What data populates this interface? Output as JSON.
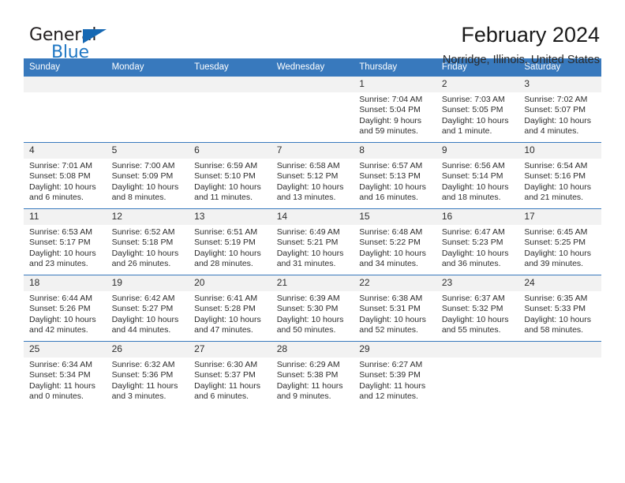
{
  "brand": {
    "name_dark": "General",
    "name_blue": "Blue",
    "accent_color": "#1f77c4",
    "triangle_color": "#1668b3"
  },
  "header": {
    "title": "February 2024",
    "subtitle": "Norridge, Illinois, United States",
    "header_bg": "#3879bd",
    "daynum_bg": "#f2f2f2"
  },
  "weekdays": [
    "Sunday",
    "Monday",
    "Tuesday",
    "Wednesday",
    "Thursday",
    "Friday",
    "Saturday"
  ],
  "weeks": [
    [
      {
        "day": ""
      },
      {
        "day": ""
      },
      {
        "day": ""
      },
      {
        "day": ""
      },
      {
        "day": "1",
        "sunrise": "Sunrise: 7:04 AM",
        "sunset": "Sunset: 5:04 PM",
        "daylight1": "Daylight: 9 hours",
        "daylight2": "and 59 minutes."
      },
      {
        "day": "2",
        "sunrise": "Sunrise: 7:03 AM",
        "sunset": "Sunset: 5:05 PM",
        "daylight1": "Daylight: 10 hours",
        "daylight2": "and 1 minute."
      },
      {
        "day": "3",
        "sunrise": "Sunrise: 7:02 AM",
        "sunset": "Sunset: 5:07 PM",
        "daylight1": "Daylight: 10 hours",
        "daylight2": "and 4 minutes."
      }
    ],
    [
      {
        "day": "4",
        "sunrise": "Sunrise: 7:01 AM",
        "sunset": "Sunset: 5:08 PM",
        "daylight1": "Daylight: 10 hours",
        "daylight2": "and 6 minutes."
      },
      {
        "day": "5",
        "sunrise": "Sunrise: 7:00 AM",
        "sunset": "Sunset: 5:09 PM",
        "daylight1": "Daylight: 10 hours",
        "daylight2": "and 8 minutes."
      },
      {
        "day": "6",
        "sunrise": "Sunrise: 6:59 AM",
        "sunset": "Sunset: 5:10 PM",
        "daylight1": "Daylight: 10 hours",
        "daylight2": "and 11 minutes."
      },
      {
        "day": "7",
        "sunrise": "Sunrise: 6:58 AM",
        "sunset": "Sunset: 5:12 PM",
        "daylight1": "Daylight: 10 hours",
        "daylight2": "and 13 minutes."
      },
      {
        "day": "8",
        "sunrise": "Sunrise: 6:57 AM",
        "sunset": "Sunset: 5:13 PM",
        "daylight1": "Daylight: 10 hours",
        "daylight2": "and 16 minutes."
      },
      {
        "day": "9",
        "sunrise": "Sunrise: 6:56 AM",
        "sunset": "Sunset: 5:14 PM",
        "daylight1": "Daylight: 10 hours",
        "daylight2": "and 18 minutes."
      },
      {
        "day": "10",
        "sunrise": "Sunrise: 6:54 AM",
        "sunset": "Sunset: 5:16 PM",
        "daylight1": "Daylight: 10 hours",
        "daylight2": "and 21 minutes."
      }
    ],
    [
      {
        "day": "11",
        "sunrise": "Sunrise: 6:53 AM",
        "sunset": "Sunset: 5:17 PM",
        "daylight1": "Daylight: 10 hours",
        "daylight2": "and 23 minutes."
      },
      {
        "day": "12",
        "sunrise": "Sunrise: 6:52 AM",
        "sunset": "Sunset: 5:18 PM",
        "daylight1": "Daylight: 10 hours",
        "daylight2": "and 26 minutes."
      },
      {
        "day": "13",
        "sunrise": "Sunrise: 6:51 AM",
        "sunset": "Sunset: 5:19 PM",
        "daylight1": "Daylight: 10 hours",
        "daylight2": "and 28 minutes."
      },
      {
        "day": "14",
        "sunrise": "Sunrise: 6:49 AM",
        "sunset": "Sunset: 5:21 PM",
        "daylight1": "Daylight: 10 hours",
        "daylight2": "and 31 minutes."
      },
      {
        "day": "15",
        "sunrise": "Sunrise: 6:48 AM",
        "sunset": "Sunset: 5:22 PM",
        "daylight1": "Daylight: 10 hours",
        "daylight2": "and 34 minutes."
      },
      {
        "day": "16",
        "sunrise": "Sunrise: 6:47 AM",
        "sunset": "Sunset: 5:23 PM",
        "daylight1": "Daylight: 10 hours",
        "daylight2": "and 36 minutes."
      },
      {
        "day": "17",
        "sunrise": "Sunrise: 6:45 AM",
        "sunset": "Sunset: 5:25 PM",
        "daylight1": "Daylight: 10 hours",
        "daylight2": "and 39 minutes."
      }
    ],
    [
      {
        "day": "18",
        "sunrise": "Sunrise: 6:44 AM",
        "sunset": "Sunset: 5:26 PM",
        "daylight1": "Daylight: 10 hours",
        "daylight2": "and 42 minutes."
      },
      {
        "day": "19",
        "sunrise": "Sunrise: 6:42 AM",
        "sunset": "Sunset: 5:27 PM",
        "daylight1": "Daylight: 10 hours",
        "daylight2": "and 44 minutes."
      },
      {
        "day": "20",
        "sunrise": "Sunrise: 6:41 AM",
        "sunset": "Sunset: 5:28 PM",
        "daylight1": "Daylight: 10 hours",
        "daylight2": "and 47 minutes."
      },
      {
        "day": "21",
        "sunrise": "Sunrise: 6:39 AM",
        "sunset": "Sunset: 5:30 PM",
        "daylight1": "Daylight: 10 hours",
        "daylight2": "and 50 minutes."
      },
      {
        "day": "22",
        "sunrise": "Sunrise: 6:38 AM",
        "sunset": "Sunset: 5:31 PM",
        "daylight1": "Daylight: 10 hours",
        "daylight2": "and 52 minutes."
      },
      {
        "day": "23",
        "sunrise": "Sunrise: 6:37 AM",
        "sunset": "Sunset: 5:32 PM",
        "daylight1": "Daylight: 10 hours",
        "daylight2": "and 55 minutes."
      },
      {
        "day": "24",
        "sunrise": "Sunrise: 6:35 AM",
        "sunset": "Sunset: 5:33 PM",
        "daylight1": "Daylight: 10 hours",
        "daylight2": "and 58 minutes."
      }
    ],
    [
      {
        "day": "25",
        "sunrise": "Sunrise: 6:34 AM",
        "sunset": "Sunset: 5:34 PM",
        "daylight1": "Daylight: 11 hours",
        "daylight2": "and 0 minutes."
      },
      {
        "day": "26",
        "sunrise": "Sunrise: 6:32 AM",
        "sunset": "Sunset: 5:36 PM",
        "daylight1": "Daylight: 11 hours",
        "daylight2": "and 3 minutes."
      },
      {
        "day": "27",
        "sunrise": "Sunrise: 6:30 AM",
        "sunset": "Sunset: 5:37 PM",
        "daylight1": "Daylight: 11 hours",
        "daylight2": "and 6 minutes."
      },
      {
        "day": "28",
        "sunrise": "Sunrise: 6:29 AM",
        "sunset": "Sunset: 5:38 PM",
        "daylight1": "Daylight: 11 hours",
        "daylight2": "and 9 minutes."
      },
      {
        "day": "29",
        "sunrise": "Sunrise: 6:27 AM",
        "sunset": "Sunset: 5:39 PM",
        "daylight1": "Daylight: 11 hours",
        "daylight2": "and 12 minutes."
      },
      {
        "day": ""
      },
      {
        "day": ""
      }
    ]
  ]
}
